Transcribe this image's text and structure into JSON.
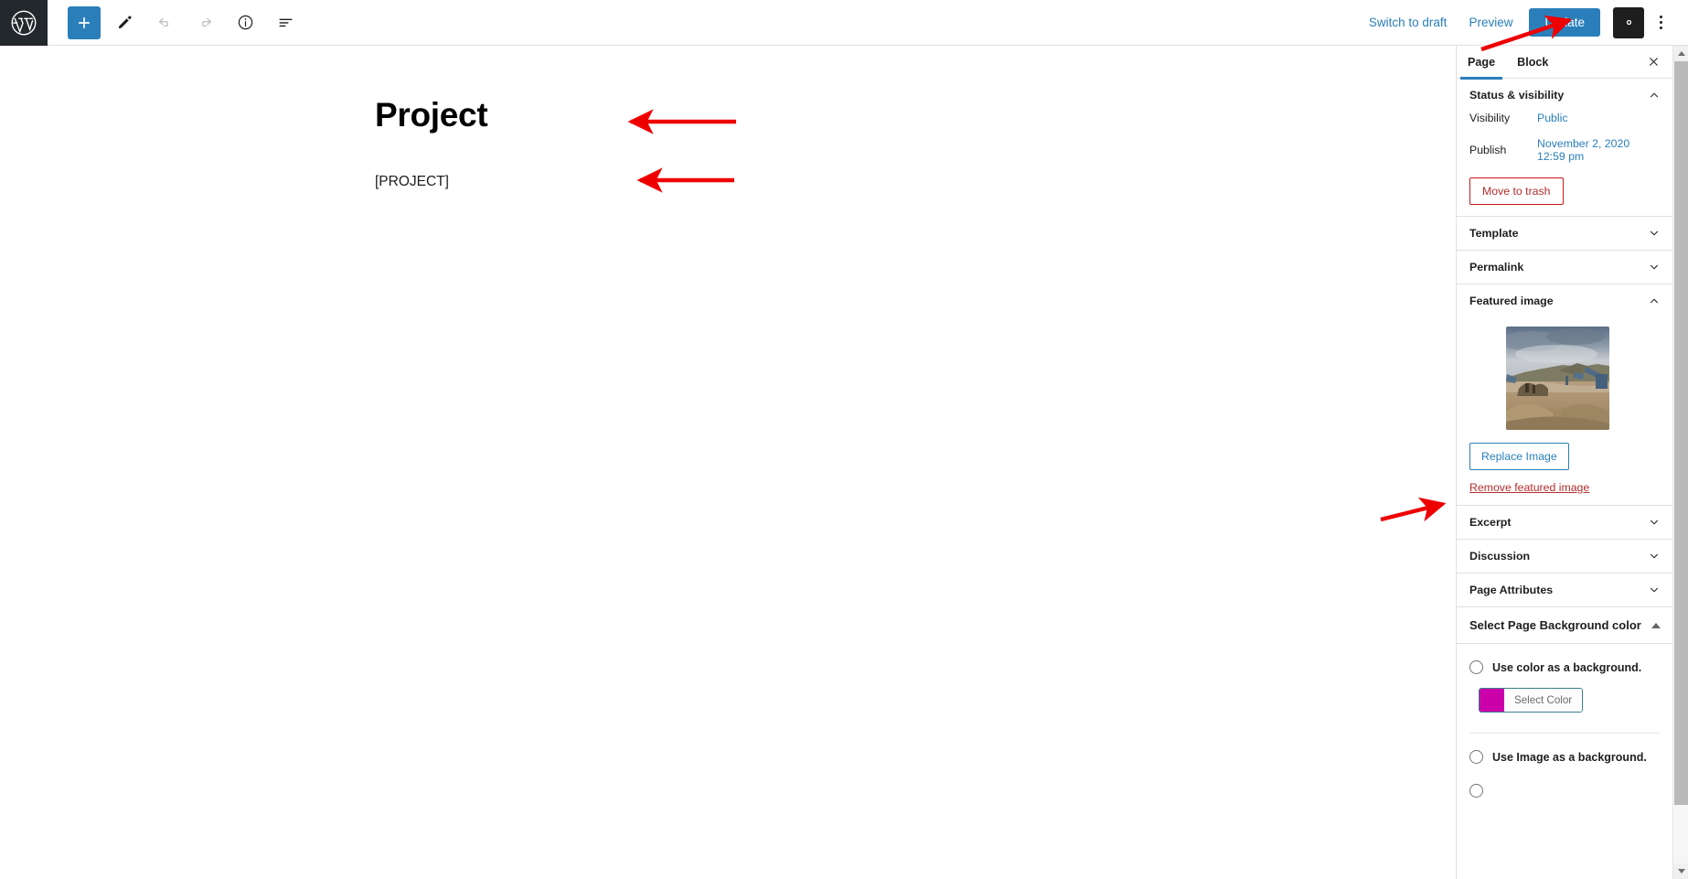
{
  "app": {
    "name": "WordPress Block Editor",
    "logo_icon": "wordpress-logo-icon"
  },
  "toolbar": {
    "add_block_label": "+",
    "add_block_icon": "plus-icon",
    "tools_icon": "pencil-icon",
    "undo_icon": "undo-arrow-icon",
    "redo_icon": "redo-arrow-icon",
    "info_icon": "info-circle-icon",
    "list_view_icon": "list-view-icon",
    "switch_to_draft": "Switch to draft",
    "preview": "Preview",
    "update": "Update",
    "settings_icon": "gear-icon",
    "more_options_icon": "ellipsis-vertical-icon"
  },
  "editor": {
    "title": "Project",
    "paragraph": "[PROJECT]"
  },
  "sidebar": {
    "tabs": [
      {
        "label": "Page",
        "active": true
      },
      {
        "label": "Block",
        "active": false
      }
    ],
    "close_icon": "close-icon",
    "status_visibility": {
      "title": "Status & visibility",
      "collapse_icon": "chevron-up-icon",
      "visibility_label": "Visibility",
      "visibility_value": "Public",
      "publish_label": "Publish",
      "publish_value": "November 2, 2020 12:59 pm",
      "trash_label": "Move to trash"
    },
    "template": {
      "title": "Template",
      "expand_icon": "chevron-down-icon"
    },
    "permalink": {
      "title": "Permalink",
      "expand_icon": "chevron-down-icon"
    },
    "featured_image": {
      "title": "Featured image",
      "collapse_icon": "chevron-up-icon",
      "thumbnail_alt": "quarry-mining-site-thumbnail",
      "replace_label": "Replace Image",
      "remove_label": "Remove featured image"
    },
    "excerpt": {
      "title": "Excerpt",
      "expand_icon": "chevron-down-icon"
    },
    "discussion": {
      "title": "Discussion",
      "expand_icon": "chevron-down-icon"
    },
    "page_attributes": {
      "title": "Page Attributes",
      "expand_icon": "chevron-down-icon"
    },
    "background": {
      "title": "Select Page Background color",
      "collapse_icon": "triangle-up-icon",
      "use_color_label": "Use color as a background.",
      "select_color_label": "Select Color",
      "selected_color": "#cc00aa",
      "use_image_label": "Use Image as a background."
    }
  },
  "colors": {
    "accent_blue": "#2a7fbb",
    "danger_red": "#b32d2e",
    "annotation_red": "#ee0000",
    "swatch_magenta": "#cc00aa",
    "admin_dark": "#23282d"
  },
  "annotations": {
    "arrow_to_update": "red-arrow-pointing-to-update-button",
    "arrow_to_title": "red-arrow-pointing-to-page-title",
    "arrow_to_paragraph": "red-arrow-pointing-to-paragraph-block",
    "arrow_to_replace_image": "red-arrow-pointing-to-replace-image-button"
  }
}
